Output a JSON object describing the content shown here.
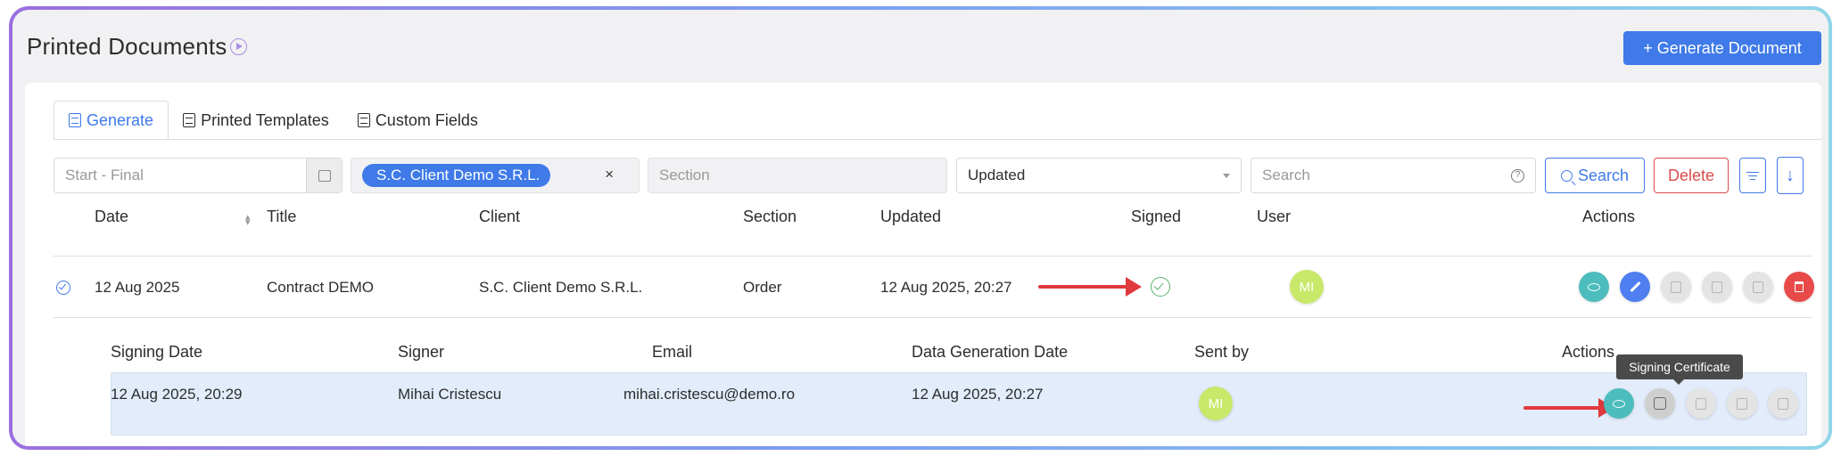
{
  "page": {
    "title": "Printed Documents",
    "generate_button": "+ Generate Document"
  },
  "tabs": [
    {
      "label": "Generate",
      "active": true
    },
    {
      "label": "Printed Templates",
      "active": false
    },
    {
      "label": "Custom Fields",
      "active": false
    }
  ],
  "filters": {
    "date_placeholder": "Start - Final",
    "client_chip": "S.C. Client Demo S.R.L.",
    "client_clear": "×",
    "section_placeholder": "Section",
    "sort_value": "Updated",
    "search_placeholder": "Search",
    "search_button": "Search",
    "delete_button": "Delete"
  },
  "table": {
    "headers": {
      "date": "Date",
      "title": "Title",
      "client": "Client",
      "section": "Section",
      "updated": "Updated",
      "signed": "Signed",
      "user": "User",
      "actions": "Actions"
    },
    "rows": [
      {
        "date": "12 Aug 2025",
        "title": "Contract DEMO",
        "client": "S.C. Client Demo S.R.L.",
        "section": "Order",
        "updated": "12 Aug 2025, 20:27",
        "signed": true,
        "user_initials": "MI"
      }
    ]
  },
  "signatures": {
    "headers": {
      "signing_date": "Signing Date",
      "signer": "Signer",
      "email": "Email",
      "data_generation_date": "Data Generation Date",
      "sent_by": "Sent by",
      "actions": "Actions"
    },
    "rows": [
      {
        "signing_date": "12 Aug 2025, 20:29",
        "signer": "Mihai Cristescu",
        "email": "mihai.cristescu@demo.ro",
        "data_generation_date": "12 Aug 2025, 20:27",
        "sent_by_initials": "MI"
      }
    ]
  },
  "tooltip": "Signing Certificate",
  "colors": {
    "accent": "#3f7ae8",
    "danger": "#e84a4a",
    "teal": "#4cbcbc",
    "avatar": "#c8e86a",
    "annotation_arrow": "#e0393d"
  }
}
